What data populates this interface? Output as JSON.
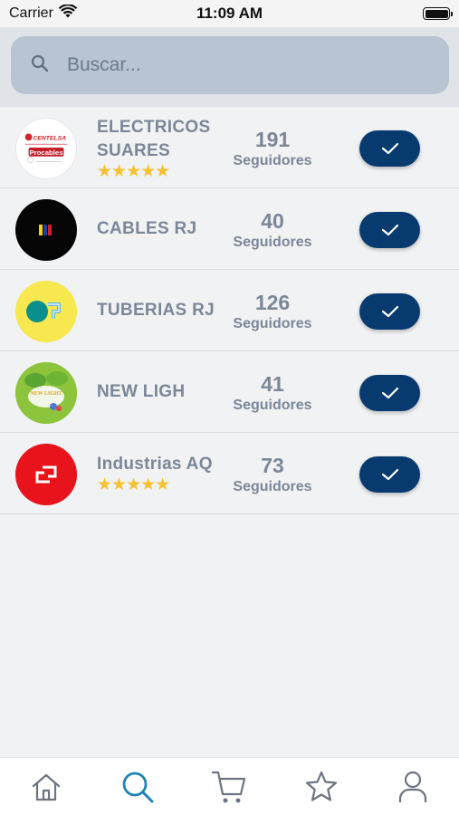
{
  "status_bar": {
    "carrier": "Carrier",
    "time": "11:09 AM"
  },
  "search": {
    "placeholder": "Buscar...",
    "value": ""
  },
  "stores": [
    {
      "name_line1": "ELECTRICOS",
      "name_line2": "SUARES",
      "stars": "★★★★★",
      "followers": "191",
      "followers_label": "Seguidores",
      "logo_text_1": "CENTELSA",
      "logo_text_2": "Procables"
    },
    {
      "name_line1": "CABLES RJ",
      "name_line2": "",
      "stars": "",
      "followers": "40",
      "followers_label": "Seguidores"
    },
    {
      "name_line1": "TUBERIAS RJ",
      "name_line2": "",
      "stars": "",
      "followers": "126",
      "followers_label": "Seguidores"
    },
    {
      "name_line1": "NEW LIGH",
      "name_line2": "",
      "stars": "",
      "followers": "41",
      "followers_label": "Seguidores",
      "logo_text_1": "NEW LIGHT"
    },
    {
      "name_line1": "Industrias AQ",
      "name_line2": "",
      "stars": "★★★★★",
      "followers": "73",
      "followers_label": "Seguidores"
    }
  ],
  "tabs": [
    "home-icon",
    "search-icon",
    "cart-icon",
    "star-icon",
    "user-icon"
  ],
  "colors": {
    "accent": "#073b6f",
    "active_tab": "#1f83b5",
    "inactive_tab": "#6d7480",
    "star": "#f5c12e",
    "text": "#7b8797"
  }
}
